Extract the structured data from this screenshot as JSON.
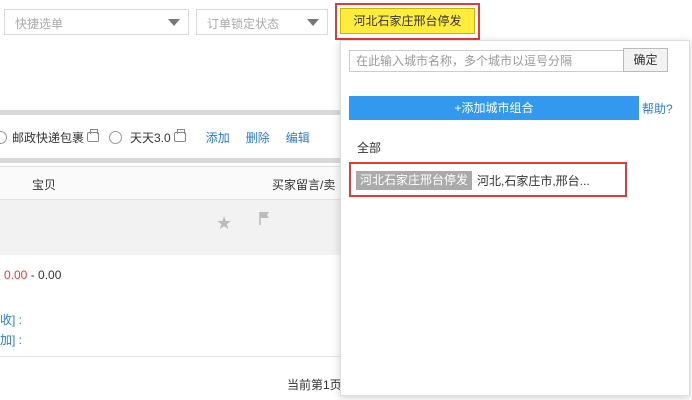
{
  "filters": {
    "quick_select_placeholder": "快捷选单",
    "lock_status_placeholder": "订单锁定状态"
  },
  "active_combo_button": "河北石家庄邢台停发",
  "shipping": {
    "options": [
      "邮政快递包裹",
      "天天3.0"
    ],
    "actions": [
      "添加",
      "删除",
      "编辑"
    ]
  },
  "table": {
    "col_item": "宝贝",
    "col_message": "买家留言/卖"
  },
  "order": {
    "price_low": "0.00",
    "price_sep": " - ",
    "price_high": "0.00",
    "link1": "收] :",
    "link2": "加] :"
  },
  "pager_text": "当前第1页",
  "popup": {
    "city_input_placeholder": "在此输入城市名称，多个城市以逗号分隔",
    "confirm_label": "确定",
    "add_combo_label": "+添加城市组合",
    "help_label": "帮助?",
    "all_label": "全部",
    "combo": {
      "name": "河北石家庄邢台停发",
      "cities": "河北,石家庄市,邢台..."
    }
  },
  "colors": {
    "highlight_yellow": "#ffec3d",
    "annotation_red": "#e03a3a",
    "primary_blue": "#3399ee",
    "link_blue": "#2b7bd3",
    "price_red": "#e53935"
  }
}
